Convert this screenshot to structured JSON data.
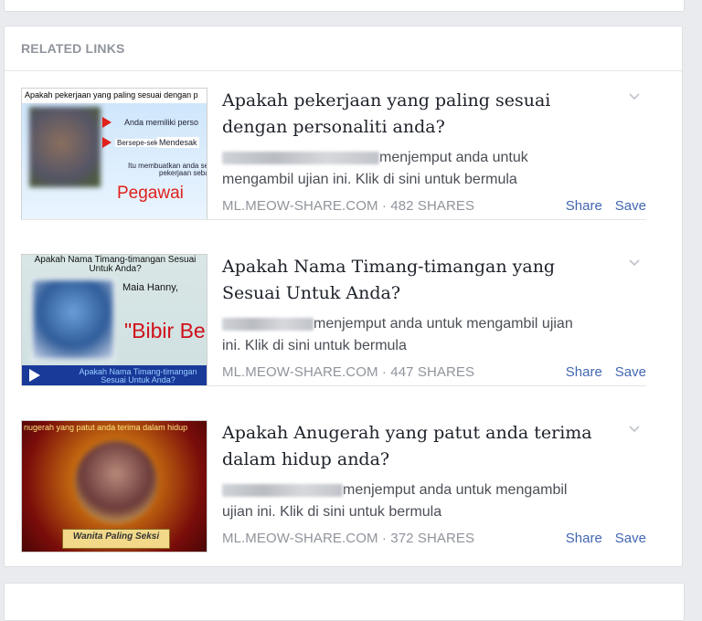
{
  "section": {
    "title": "RELATED LINKS"
  },
  "items": [
    {
      "headline": "Apakah pekerjaan yang paling sesuai dengan personaliti anda?",
      "desc_line1": "menjemput anda untuk",
      "desc_line2": "mengambil ujian ini. Klik di sini untuk bermula",
      "domain": "ML.MEOW-SHARE.COM",
      "shares": "482 SHARES",
      "share_label": "Share",
      "save_label": "Save",
      "thumb": {
        "caption": "Apakah pekerjaan yang paling sesuai dengan p",
        "line1": "Anda memiliki perso",
        "line2": "Bersepe-sekan",
        "line3": "Mendesak",
        "line4": "Itu membuatkan anda se",
        "line5": "pekerjaan seba",
        "big": "Pegawai"
      }
    },
    {
      "headline": "Apakah Nama Timang-timangan yang Sesuai Untuk Anda?",
      "desc_line1": "menjemput anda untuk mengambil ujian",
      "desc_line2": "ini. Klik di sini untuk bermula",
      "domain": "ML.MEOW-SHARE.COM",
      "shares": "447 SHARES",
      "share_label": "Share",
      "save_label": "Save",
      "thumb": {
        "caption": "Apakah Nama Timang-timangan Sesuai Untuk Anda?",
        "name": "Maia Hanny,",
        "big": "\"Bibir Be",
        "bar": "Apakah Nama Timang-timangan Sesuai Untuk Anda?"
      }
    },
    {
      "headline": "Apakah Anugerah yang patut anda terima dalam hidup anda?",
      "desc_line1": "menjemput anda untuk mengambil",
      "desc_line2": "ujian ini. Klik di sini untuk bermula",
      "domain": "ML.MEOW-SHARE.COM",
      "shares": "372 SHARES",
      "share_label": "Share",
      "save_label": "Save",
      "thumb": {
        "caption": "nugerah yang patut anda terima dalam hidup",
        "ribbon": "Wanita Paling Seksi"
      }
    }
  ],
  "icons": {
    "menu": "chevron-down-icon",
    "play": "play-icon"
  },
  "colors": {
    "link": "#4267b2",
    "meta": "#90949c",
    "headline": "#1d2129"
  }
}
